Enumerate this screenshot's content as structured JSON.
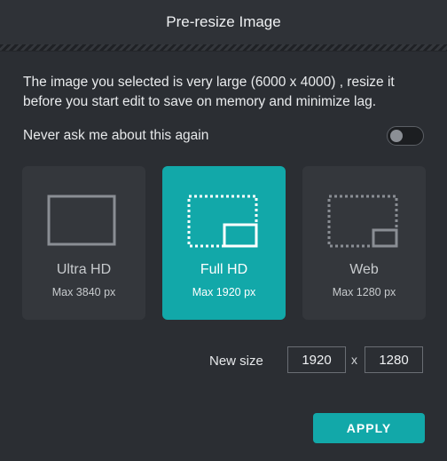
{
  "dialog": {
    "title": "Pre-resize Image",
    "description": "The image you selected is very large (6000 x 4000) , resize it before you start edit to save on memory and minimize lag.",
    "never_ask_label": "Never ask me about this again",
    "never_ask_enabled": false
  },
  "options": [
    {
      "label": "Ultra HD",
      "sub": "Max 3840 px",
      "icon": "ultra-hd-frame-icon",
      "selected": false
    },
    {
      "label": "Full HD",
      "sub": "Max 1920 px",
      "icon": "full-hd-resize-icon",
      "selected": true
    },
    {
      "label": "Web",
      "sub": "Max 1280 px",
      "icon": "web-resize-icon",
      "selected": false
    }
  ],
  "new_size": {
    "label": "New size",
    "width": "1920",
    "height": "1280",
    "separator": "x"
  },
  "apply_label": "APPLY",
  "colors": {
    "accent": "#12a8a9",
    "background": "#2b2e33",
    "card": "#34373c"
  }
}
